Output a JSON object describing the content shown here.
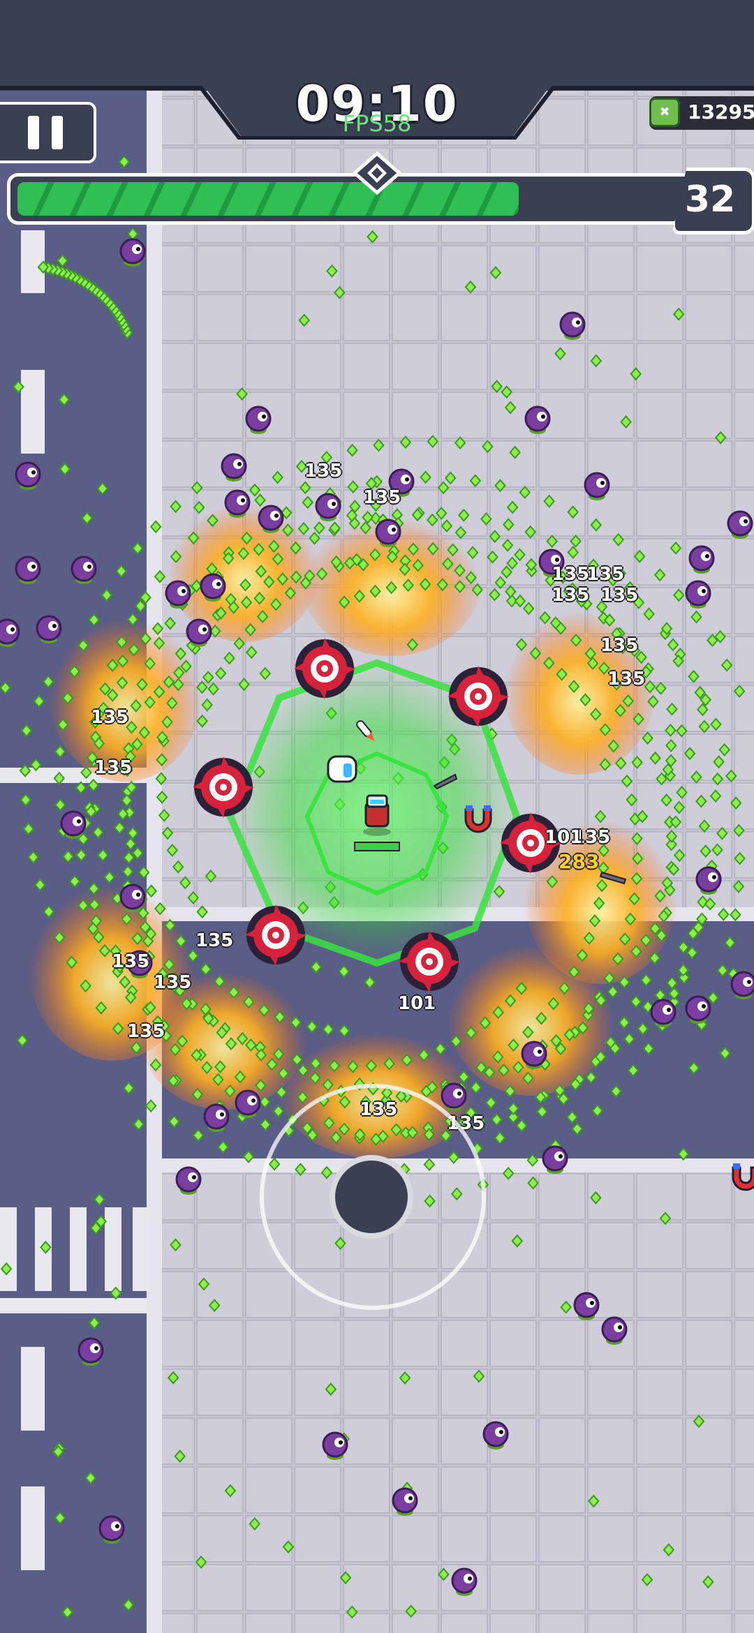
{
  "hud": {
    "timer": "09:10",
    "fps": "FPS58",
    "coins": "13295",
    "level": "32",
    "xp_progress": 0.69
  },
  "damage_numbers": [
    {
      "text": "135",
      "crit": false
    },
    {
      "text": "135",
      "crit": false
    },
    {
      "text": "135",
      "crit": false
    },
    {
      "text": "135",
      "crit": false
    },
    {
      "text": "135",
      "crit": false
    },
    {
      "text": "135",
      "crit": false
    },
    {
      "text": "135",
      "crit": false
    },
    {
      "text": "135",
      "crit": false
    },
    {
      "text": "135",
      "crit": false
    },
    {
      "text": "135",
      "crit": false
    },
    {
      "text": "135",
      "crit": false
    },
    {
      "text": "135",
      "crit": false
    },
    {
      "text": "135",
      "crit": false
    },
    {
      "text": "135",
      "crit": false
    },
    {
      "text": "135",
      "crit": false
    },
    {
      "text": "135",
      "crit": false
    },
    {
      "text": "135",
      "crit": false
    },
    {
      "text": "101",
      "crit": false
    },
    {
      "text": "101",
      "crit": false
    },
    {
      "text": "283",
      "crit": true
    }
  ],
  "colors": {
    "hud_bg": "#3b3f52",
    "road": "#5a5d86",
    "sidewalk": "#c6c4cf",
    "xp_green": "#2fbf54",
    "gem_green": "#7ee03a",
    "enemy_purple": "#7a3ea0",
    "fire_orange": "#ff8a1e"
  },
  "icons": [
    "pause-icon",
    "coin-icon",
    "level-diamond-icon",
    "magnet-icon",
    "player-icon",
    "sawblade-icon",
    "enemy-icon",
    "xp-gem-icon"
  ]
}
